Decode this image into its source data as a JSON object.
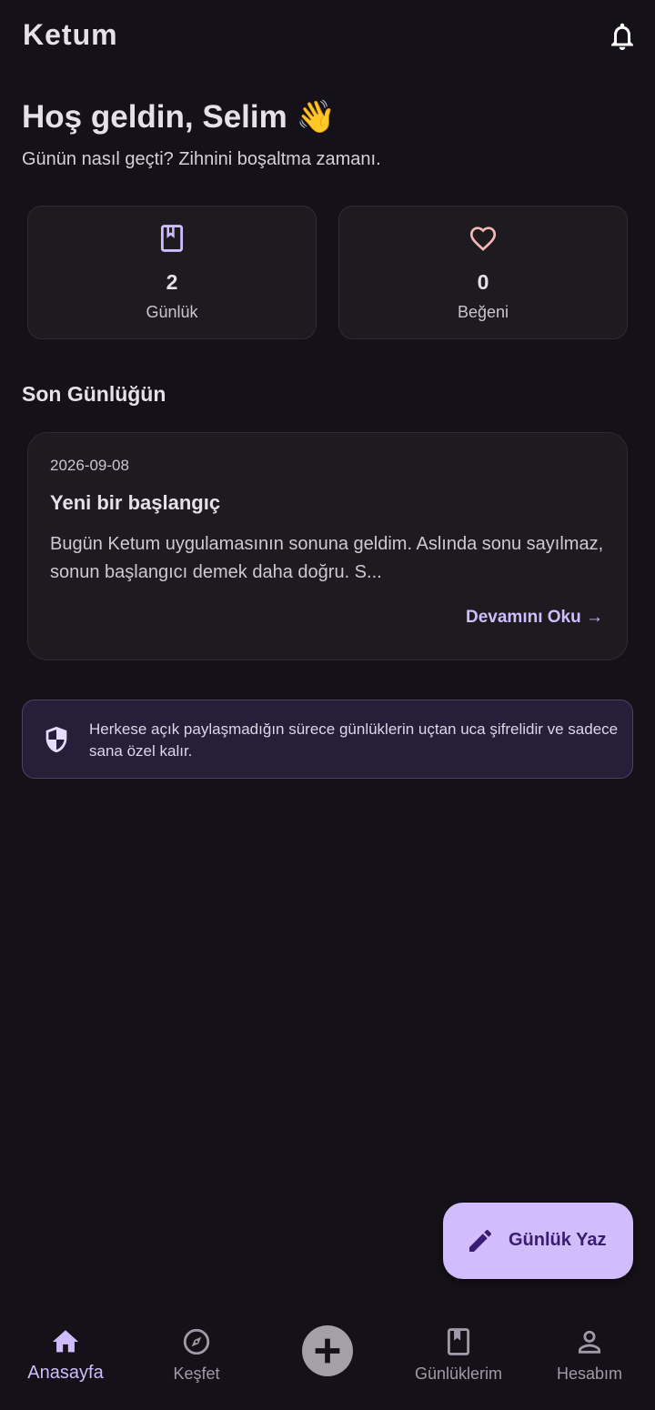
{
  "app": {
    "title": "Ketum"
  },
  "header": {
    "greeting": "Hoş geldin, Selim 👋",
    "subtitle": "Günün nasıl geçti? Zihnini boşaltma zamanı."
  },
  "stats": [
    {
      "value": "2",
      "label": "Günlük",
      "icon": "book-icon"
    },
    {
      "value": "0",
      "label": "Beğeni",
      "icon": "heart-icon"
    }
  ],
  "latest": {
    "section_title": "Son Günlüğün",
    "date": "2026-09-08",
    "title": "Yeni bir başlangıç",
    "excerpt": "Bugün Ketum uygulamasının sonuna geldim. Aslında sonu sayılmaz, sonun başlangıcı demek daha doğru. S...",
    "read_more": "Devamını Oku →"
  },
  "privacy": {
    "text": "Herkese açık paylaşmadığın sürece günlüklerin uçtan uca şifrelidir ve sadece sana özel kalır.",
    "icon": "shield-icon"
  },
  "fab": {
    "label": "Günlük Yaz",
    "icon": "pencil-icon"
  },
  "nav": {
    "items": [
      {
        "label": "Anasayfa",
        "icon": "home-icon",
        "active": true
      },
      {
        "label": "Keşfet",
        "icon": "compass-icon",
        "active": false
      },
      {
        "label": "Günlüklerim",
        "icon": "book-icon",
        "active": false
      },
      {
        "label": "Hesabım",
        "icon": "person-icon",
        "active": false
      }
    ]
  },
  "colors": {
    "background": "#141218",
    "surface": "#1d1b20",
    "accent": "#d0bcff",
    "accent_text": "#cfbcff",
    "heart": "#f2b8b5",
    "banner": "#251f3a"
  }
}
